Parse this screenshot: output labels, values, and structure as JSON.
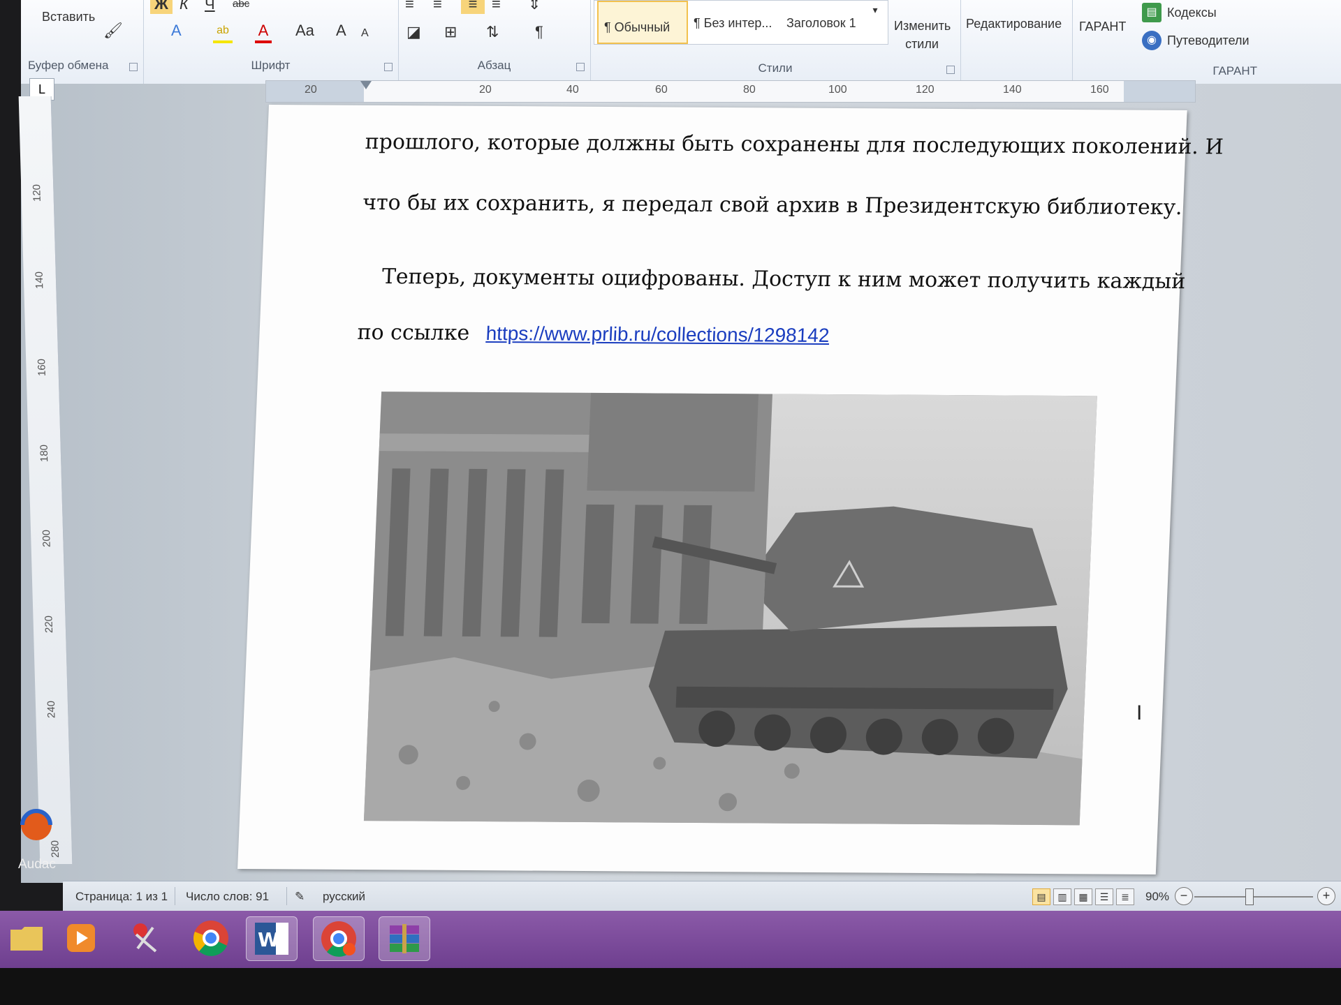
{
  "ribbon": {
    "clipboard": {
      "paste_label": "Вставить",
      "group_label": "Буфер обмена"
    },
    "font": {
      "group_label": "Шрифт",
      "case_label": "Aa",
      "grow_label": "A",
      "shrink_label": "A"
    },
    "paragraph": {
      "group_label": "Абзац",
      "pilcrow": "¶"
    },
    "styles": {
      "group_label": "Стили",
      "items": [
        "¶ Обычный",
        "¶ Без интер...",
        "Заголовок 1"
      ],
      "change_styles_label": "Изменить стили"
    },
    "editing_label": "Редактирование",
    "garant": {
      "button_label": "ГАРАНТ",
      "codexes_label": "Кодексы",
      "guides_label": "Путеводители",
      "group_label": "ГАРАНТ"
    }
  },
  "rulers": {
    "horizontal": [
      "20",
      "20",
      "40",
      "60",
      "80",
      "100",
      "120",
      "140",
      "160"
    ],
    "vertical": [
      "120",
      "140",
      "160",
      "180",
      "200",
      "220",
      "240",
      "280"
    ]
  },
  "document": {
    "line1": "прошлого, которые должны быть сохранены для последующих поколений.  И",
    "line2": "что бы их сохранить, я передал свой архив в Президентскую библиотеку.",
    "line3": "Теперь, документы оцифрованы. Доступ к ним может получить каждый",
    "line4_prefix": "по ссылке",
    "link": "https://www.prlib.ru/collections/1298142"
  },
  "statusbar": {
    "page": "Страница: 1 из 1",
    "words": "Число слов: 91",
    "language": "русский",
    "zoom": "90%"
  },
  "desktop": {
    "audacity_label": "Audac"
  },
  "colors": {
    "taskbar": "#7a4a9a",
    "link": "#1a3dbf",
    "ribbon_highlight": "#f2c14e"
  }
}
